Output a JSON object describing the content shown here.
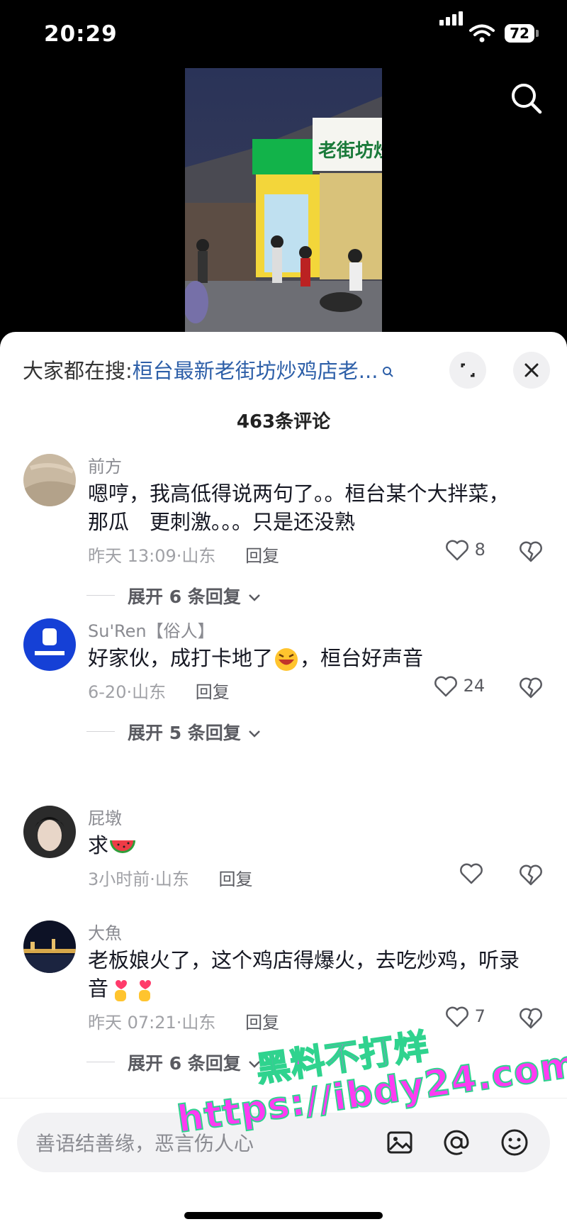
{
  "status": {
    "time": "20:29",
    "battery": "72"
  },
  "search_bar": {
    "prefix": "大家都在搜:",
    "query": "桓台最新老街坊炒鸡店老..."
  },
  "comment_count": "463条评论",
  "comments": [
    {
      "name": "前方",
      "text": "嗯哼，我高低得说两句了。。桓台某个大拌菜，那瓜　更刺激。。。只是还没熟",
      "time": "昨天 13:09·山东",
      "reply": "回复",
      "likes": "8",
      "expand": "展开 6 条回复"
    },
    {
      "name": "Su'Ren【俗人】",
      "text_a": "好家伙，成打卡地了",
      "text_b": "，桓台好声音",
      "time": "6-20·山东",
      "reply": "回复",
      "likes": "24",
      "expand": "展开 5 条回复"
    },
    {
      "name": "屁墩",
      "text": "求",
      "time": "3小时前·山东",
      "reply": "回复",
      "likes": ""
    },
    {
      "name": "大魚",
      "text": "老板娘火了，这个鸡店得爆火，去吃炒鸡，听录音",
      "time": "昨天 07:21·山东",
      "reply": "回复",
      "likes": "7",
      "expand": "展开 6 条回复"
    }
  ],
  "input": {
    "placeholder": "善语结善缘，恶言伤人心"
  },
  "video": {
    "sign_text": "老街坊炒鸡"
  },
  "watermark": {
    "line1": "黑料不打烊",
    "line2": "https://ibdy24.com"
  },
  "colors": {
    "link": "#2d5fa8",
    "sheet": "#ffffff",
    "meta": "#a0a1a6"
  }
}
